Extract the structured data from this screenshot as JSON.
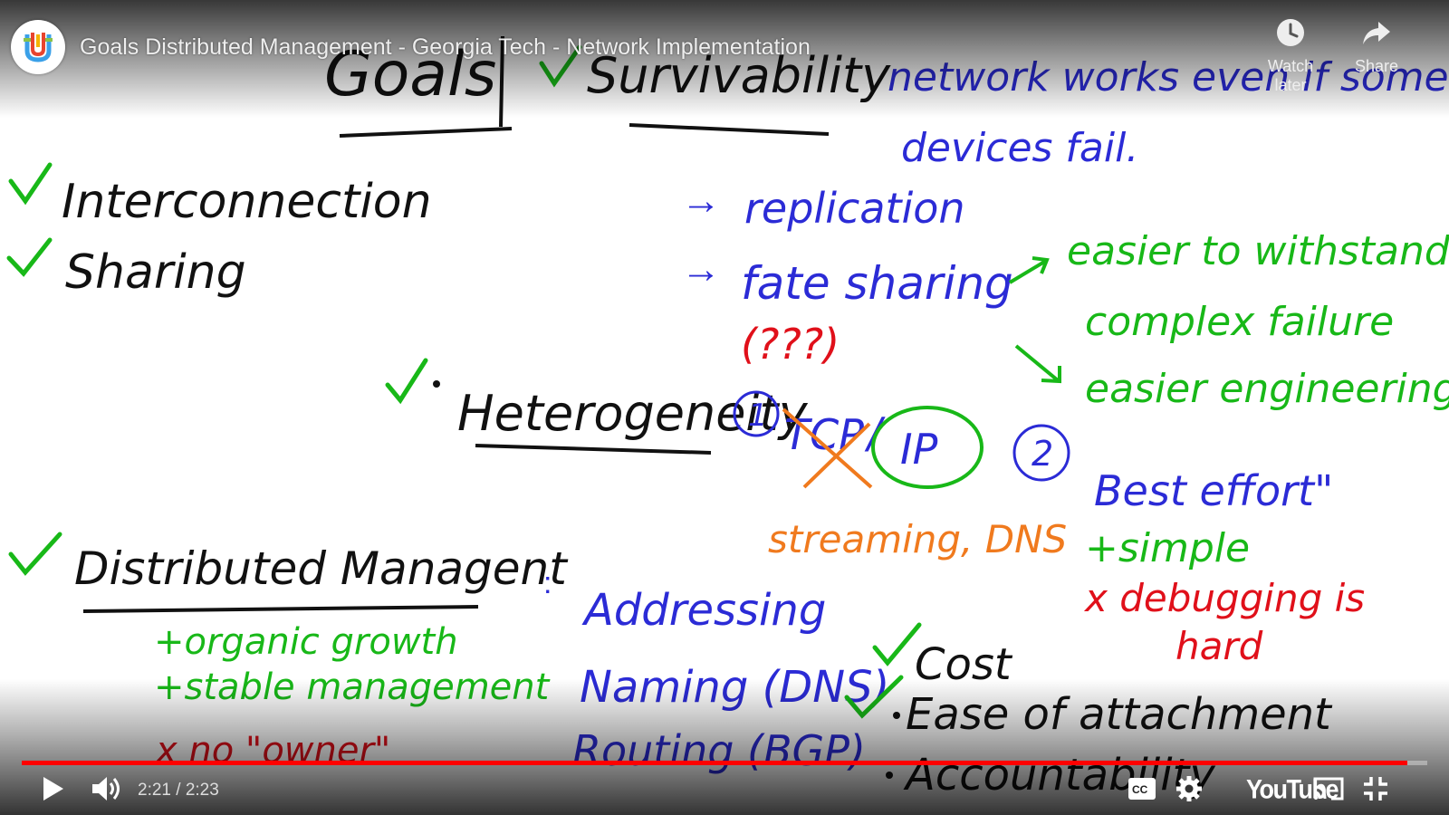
{
  "video": {
    "title": "Goals Distributed Management - Georgia Tech - Network Implementation",
    "current_time": "2:21",
    "separator": " / ",
    "duration": "2:23",
    "progress_fraction": 0.986
  },
  "actions": {
    "watch_later": "Watch later",
    "share": "Share"
  },
  "player": {
    "logo_text": "YouTube",
    "accent_color": "#ff0000"
  },
  "whiteboard": {
    "heading": "Goals",
    "goals_left": [
      "Interconnection",
      "Sharing"
    ],
    "survivability": {
      "label": "Survivability",
      "desc_1": "network works even if some",
      "desc_2": "devices fail.",
      "arrow_1": "replication",
      "arrow_2": "fate sharing",
      "benefit_1a": "easier to withstand",
      "benefit_1b": "complex failure",
      "benefit_2": "easier engineering"
    },
    "heterogeneity": {
      "label": "Heterogeneity",
      "num_1": "1",
      "tcp": "TCP",
      "slash": "/",
      "ip": "IP",
      "question": "(???)",
      "apps": "streaming, DNS",
      "num_2": "2",
      "best_effort": "Best effort\"",
      "plus": "+simple",
      "minus_1": "x debugging is",
      "minus_2": "hard"
    },
    "distributed": {
      "label": "Distributed Managent",
      "plus_1": "+organic growth",
      "plus_2": "+stable management",
      "minus": "x no \"owner\"",
      "items": [
        "Addressing",
        "Naming (DNS)",
        "Routing (BGP)"
      ]
    },
    "bottom_right": [
      "Cost",
      "Ease of attachment",
      "Accountability"
    ]
  },
  "colors": {
    "black_ink": "#111111",
    "blue_ink": "#2b2bd6",
    "green_ink": "#18b818",
    "red_ink": "#e0101a",
    "orange_ink": "#f07a1e"
  }
}
